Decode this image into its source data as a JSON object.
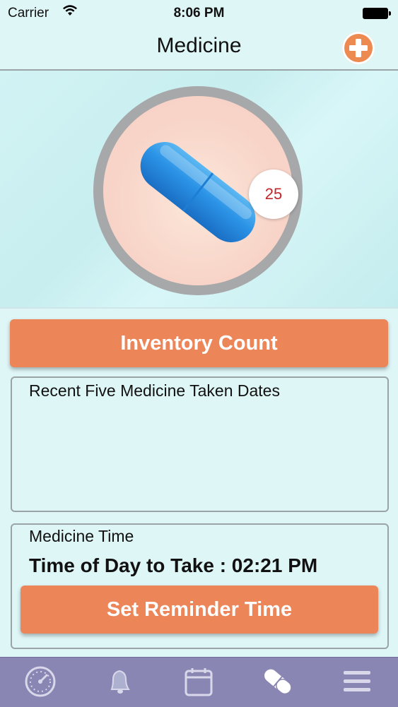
{
  "status_bar": {
    "carrier": "Carrier",
    "time": "8:06 PM"
  },
  "nav": {
    "title": "Medicine",
    "add_icon": "plus-circle-icon"
  },
  "hero": {
    "image": "pill-capsule",
    "count": "25"
  },
  "buttons": {
    "inventory": "Inventory Count",
    "reminder": "Set Reminder Time"
  },
  "recent_dates": {
    "title": "Recent Five Medicine Taken Dates",
    "items": []
  },
  "medicine_time": {
    "title": "Medicine Time",
    "time_line": "Time of Day to Take : 02:21 PM"
  },
  "tabs": [
    {
      "icon": "dashboard-gauge-icon",
      "active": false
    },
    {
      "icon": "bell-icon",
      "active": false
    },
    {
      "icon": "calendar-icon",
      "active": false
    },
    {
      "icon": "pill-icon",
      "active": true
    },
    {
      "icon": "menu-icon",
      "active": false
    }
  ],
  "colors": {
    "accent": "#ec8558",
    "background": "#dff6f7",
    "tab_bar": "#8a86b3",
    "badge_text": "#c0262a"
  }
}
